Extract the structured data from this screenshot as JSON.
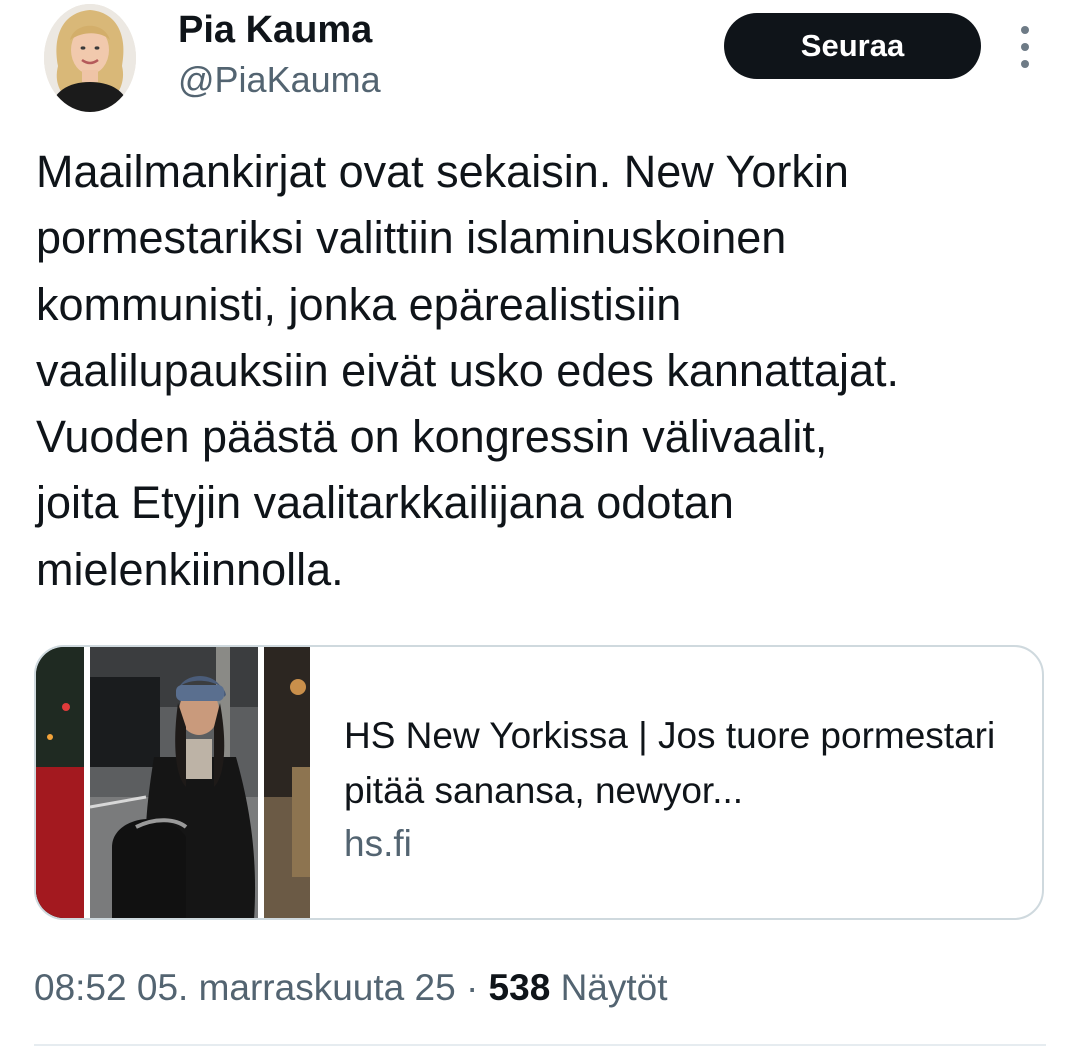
{
  "author": {
    "display_name": "Pia Kauma",
    "handle": "@PiaKauma"
  },
  "follow_button": {
    "label": "Seuraa"
  },
  "more_icon": "more-vertical-icon",
  "tweet": {
    "text": "Maailmankirjat ovat sekaisin. New Yorkin\npormestariksi valittiin islaminuskoinen\nkommunisti, jonka epärealistisiin\nvaalilupauksiin eivät usko edes kannattajat.\nVuoden päästä on kongressin välivaalit,\njoita Etyjin vaalitarkkailijana odotan\nmielenkiinnolla."
  },
  "link_card": {
    "title": "HS New Yorkissa | Jos tuore pormestari pitää sanansa, newyor...",
    "domain": "hs.fi"
  },
  "meta": {
    "timestamp": "08:52 05. marraskuuta 25",
    "separator": "·",
    "views_count": "538",
    "views_label": "Näytöt"
  },
  "colors": {
    "text_primary": "#0f1419",
    "text_secondary": "#536471",
    "button_bg": "#0f1419",
    "border": "#cfd9de"
  }
}
